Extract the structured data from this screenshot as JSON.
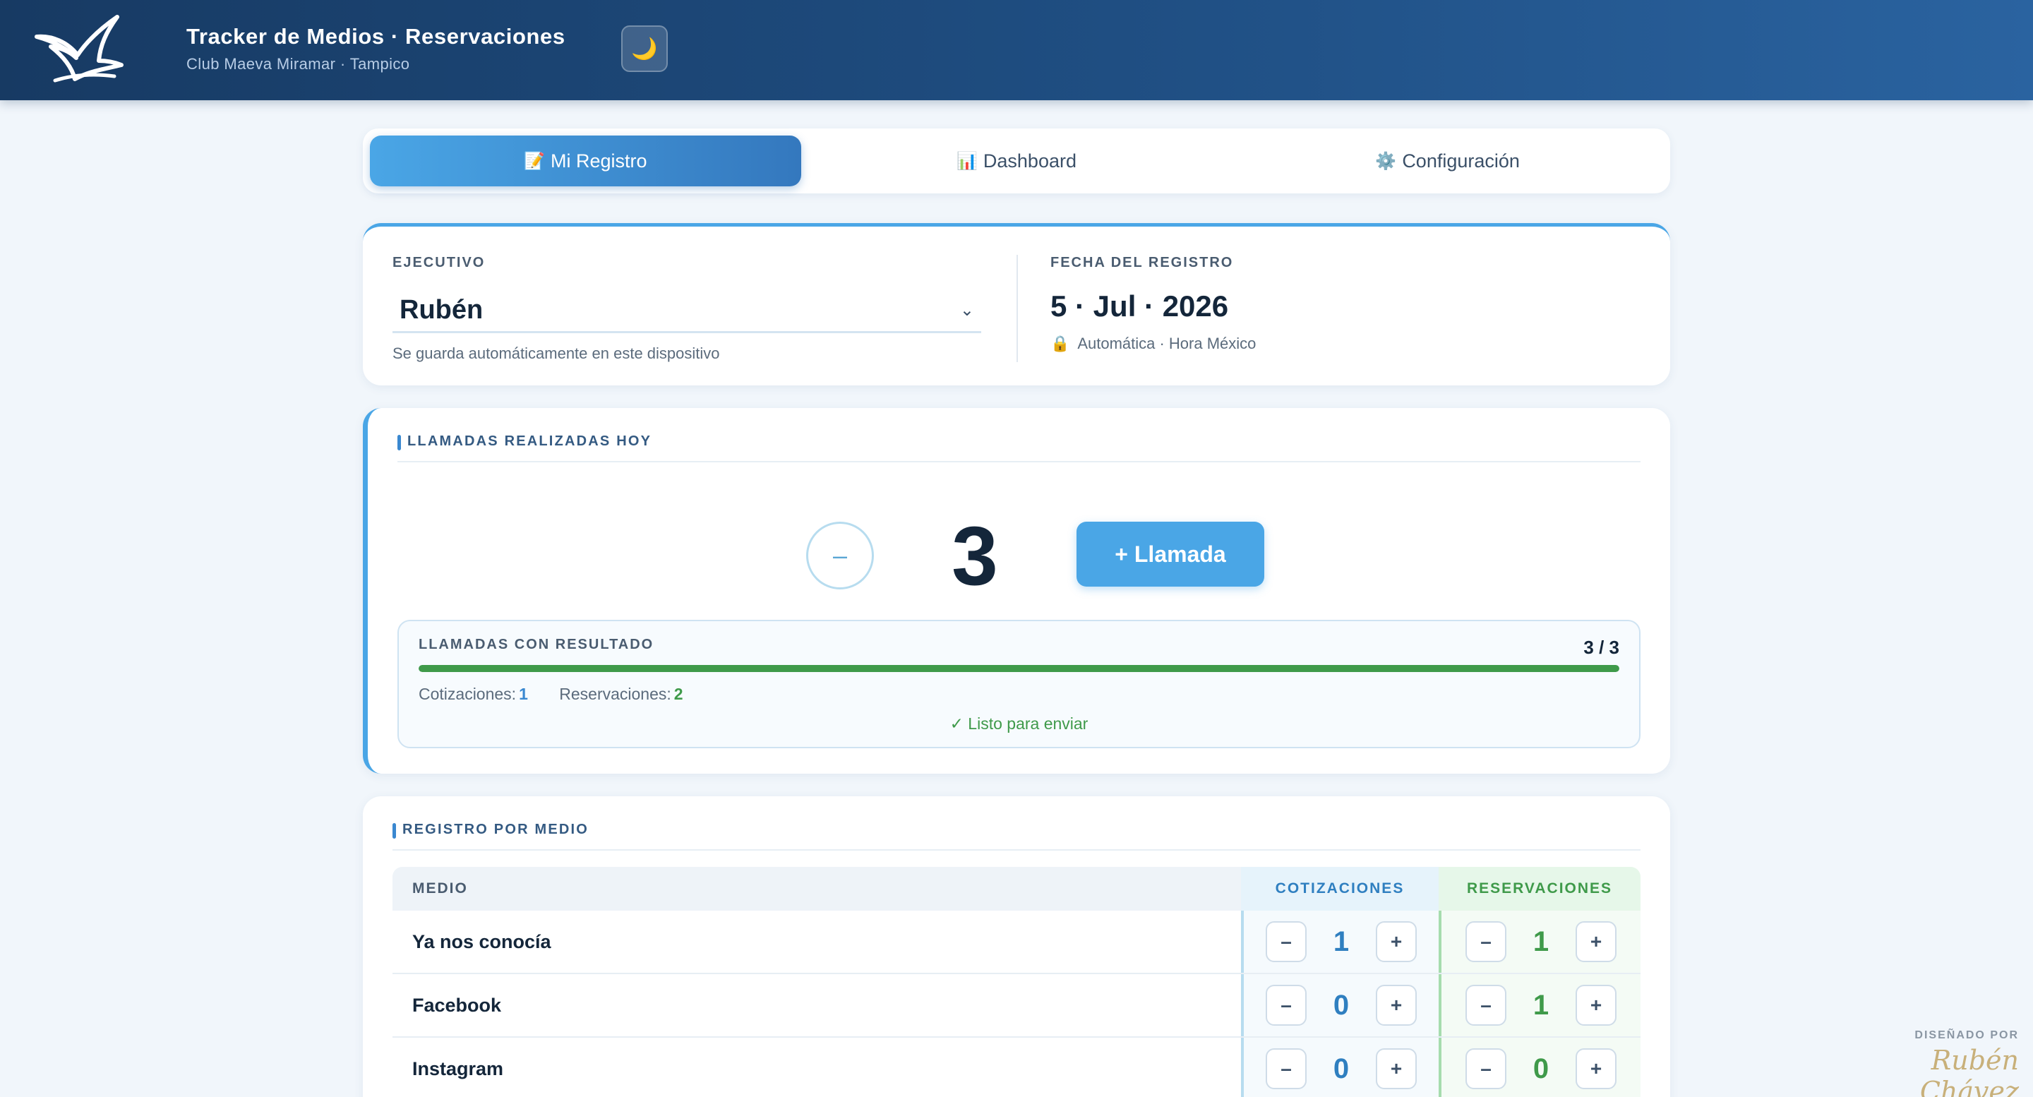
{
  "header": {
    "title": "Tracker de Medios · Reservaciones",
    "subtitle": "Club Maeva Miramar · Tampico",
    "theme_icon": "moon-icon",
    "theme_glyph": "🌙"
  },
  "tabs": [
    {
      "icon": "📝",
      "label": "Mi Registro",
      "active": true
    },
    {
      "icon": "📊",
      "label": "Dashboard",
      "active": false
    },
    {
      "icon": "⚙️",
      "label": "Configuración",
      "active": false
    }
  ],
  "ejecutivo": {
    "label": "EJECUTIVO",
    "value": "Rubén",
    "note": "Se guarda automáticamente en este dispositivo"
  },
  "fecha": {
    "label": "FECHA DEL REGISTRO",
    "value": "5 · Jul · 2026",
    "lock_glyph": "🔒",
    "note": "Automática · Hora México"
  },
  "llamadas": {
    "title": "LLAMADAS REALIZADAS HOY",
    "count": "3",
    "minus_label": "–",
    "add_label": "+ Llamada",
    "result": {
      "label": "LLAMADAS CON RESULTADO",
      "fraction": "3 / 3",
      "progress_fraction": 1.0,
      "cot_label": "Cotizaciones:",
      "cot_value": "1",
      "res_label": "Reservaciones:",
      "res_value": "2",
      "status": "✓ Listo para enviar"
    }
  },
  "medios": {
    "title": "REGISTRO POR MEDIO",
    "columns": {
      "medio": "MEDIO",
      "cot": "COTIZACIONES",
      "res": "RESERVACIONES"
    },
    "stepper": {
      "minus": "–",
      "plus": "+"
    },
    "rows": [
      {
        "medio": "Ya nos conocía",
        "cot": "1",
        "res": "1"
      },
      {
        "medio": "Facebook",
        "cot": "0",
        "res": "1"
      },
      {
        "medio": "Instagram",
        "cot": "0",
        "res": "0"
      }
    ]
  },
  "signature": {
    "label": "DISEÑADO POR",
    "name": "Rubén Chávez"
  },
  "colors": {
    "accent": "#4aa6e6",
    "header": "#1f4e82",
    "success": "#3f9a4a"
  }
}
